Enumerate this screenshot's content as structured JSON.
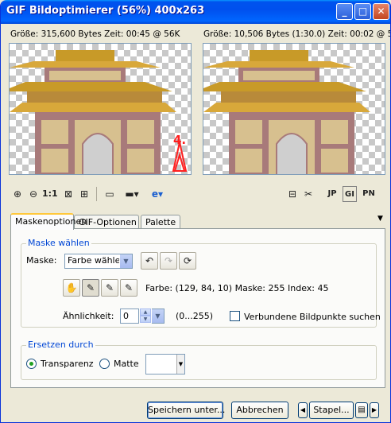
{
  "window": {
    "title": "GIF Bildoptimierer (56%) 400x263",
    "minimize": "_",
    "maximize": "□",
    "close": "✕"
  },
  "original": {
    "info": "Größe: 315,600 Bytes Zeit: 00:45 @ 56K",
    "annotation": "4."
  },
  "optimized": {
    "info": "Größe: 10,506 Bytes (1:30.0) Zeit: 00:02 @ 56K"
  },
  "toolbar": {
    "icons": [
      "zoom-in-icon",
      "zoom-out-icon",
      "actual-size-icon",
      "fit-window-icon",
      "pan-icon",
      "background-icon",
      "preview-browser-icon",
      "ie-icon"
    ],
    "one_to_one": "1:1"
  },
  "tabs": [
    {
      "label": "Maskenoptionen",
      "active": true
    },
    {
      "label": "GIF-Optionen",
      "active": false
    },
    {
      "label": "Palette",
      "active": false
    }
  ],
  "mask_group": {
    "legend": "Maske wählen",
    "mask_label": "Maske:",
    "mask_value": "Farbe wählen",
    "color_info": "Farbe: (129, 84, 10) Maske: 255 Index: 45",
    "similarity_label": "Ähnlichkeit:",
    "similarity_value": "0",
    "similarity_range": "(0...255)",
    "connected_label": "Verbundene Bildpunkte suchen"
  },
  "replace_group": {
    "legend": "Ersetzen durch",
    "transparency_label": "Transparenz",
    "matte_label": "Matte"
  },
  "buttons": {
    "save": "Speichern unter...",
    "cancel": "Abbrechen",
    "batch": "Stapel..."
  },
  "colors": {
    "title_blue": "#0050ee",
    "roof": "#c89a28",
    "wall": "#d7c08f",
    "trim": "#a87a7a",
    "annotation_red": "#ff2020"
  }
}
